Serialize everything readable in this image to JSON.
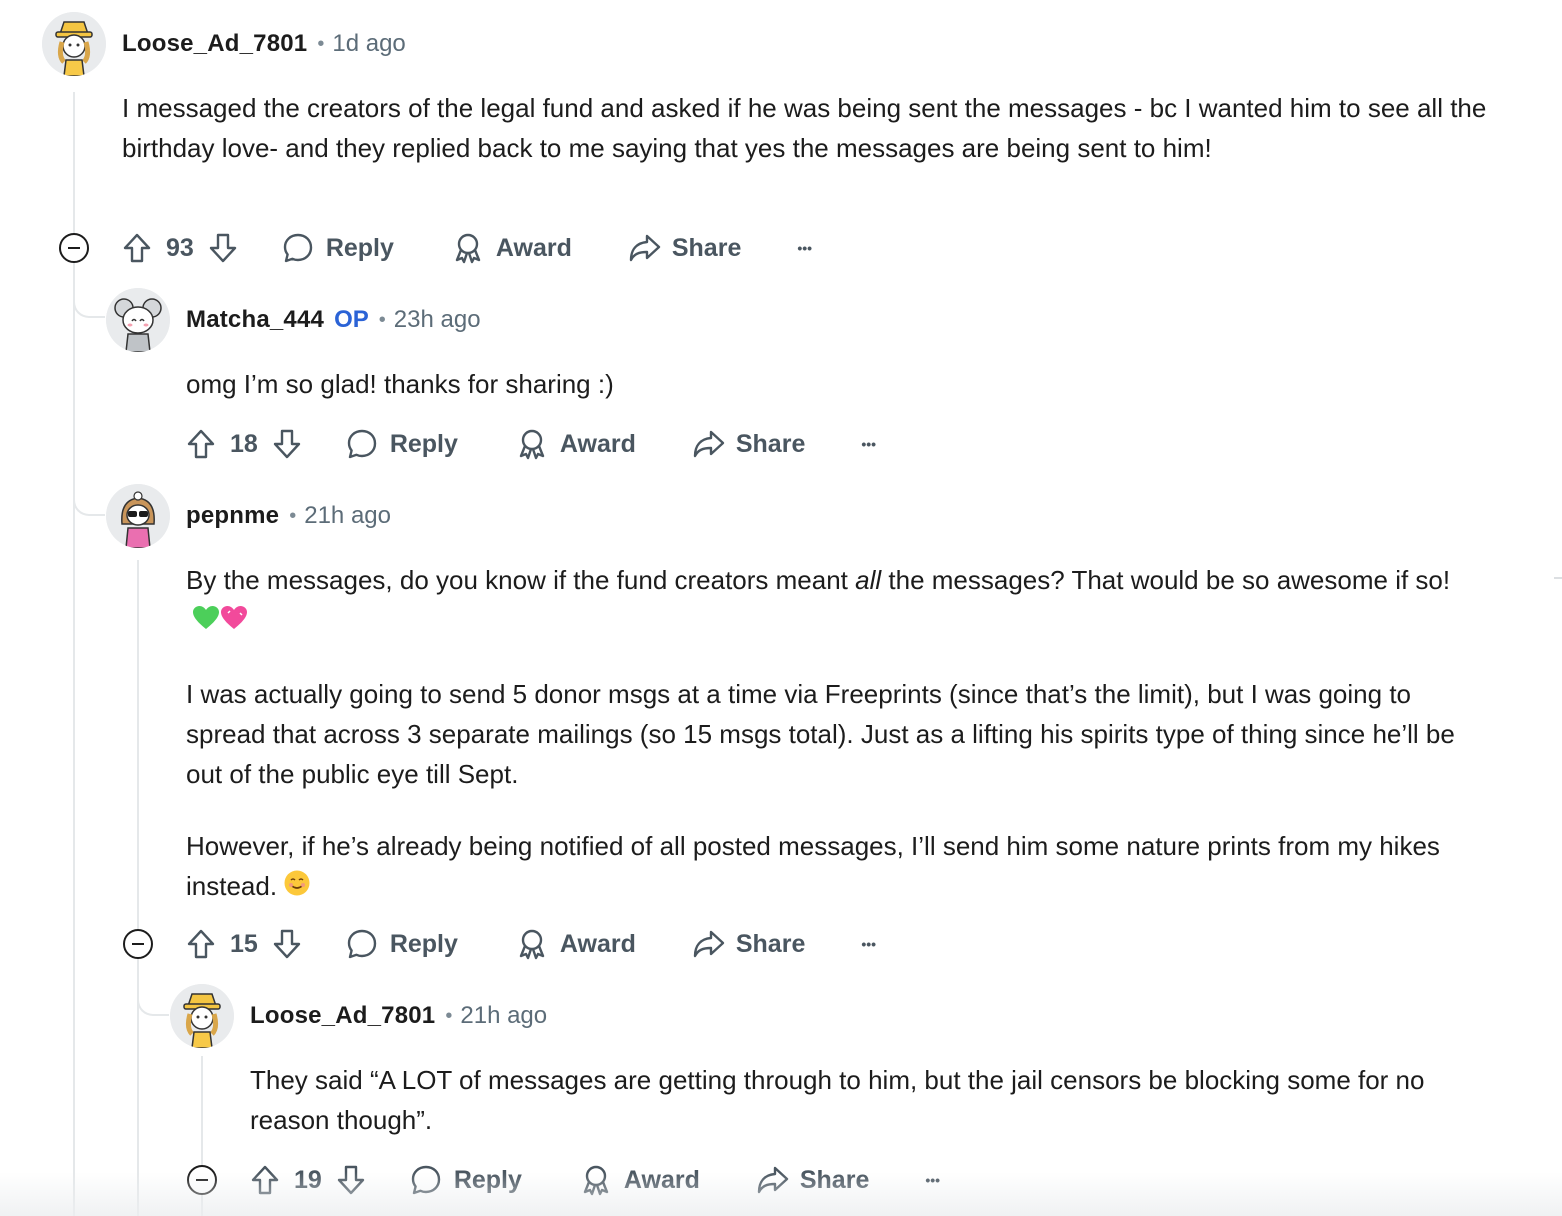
{
  "comments": [
    {
      "author": "Loose_Ad_7801",
      "time": "1d ago",
      "body": [
        "I messaged the creators of the legal fund and asked if he was being sent the messages - bc I wanted him to see all the birthday love- and they replied back to me saying that yes the messages are being sent to him!"
      ],
      "score": "93"
    },
    {
      "author": "Matcha_444",
      "op_badge": "OP",
      "time": "23h ago",
      "body": [
        "omg I’m so glad! thanks for sharing :)"
      ],
      "score": "18"
    },
    {
      "author": "pepnme",
      "time": "21h ago",
      "body_p1_before": "By the messages, do you know if the fund creators meant ",
      "body_p1_em": "all",
      "body_p1_after": " the messages? That would be so awesome if so!",
      "body_p2": "I was actually going to send 5 donor msgs at a time via Freeprints (since that’s the limit), but I was going to spread that across 3 separate mailings (so 15 msgs total). Just as a lifting his spirits type of thing since he’ll be out of the public eye till Sept.",
      "body_p3": "However, if he’s already being notified of all posted messages, I’ll send him some nature prints from my hikes instead.",
      "score": "15"
    },
    {
      "author": "Loose_Ad_7801",
      "time": "21h ago",
      "body": [
        "They said “A LOT of messages are getting through to him, but the jail censors be blocking some for no reason though”."
      ],
      "score": "19"
    }
  ],
  "actions": {
    "reply": "Reply",
    "award": "Award",
    "share": "Share",
    "more": "•••"
  },
  "icons": {
    "upvote": "upvote-arrow-icon",
    "downvote": "downvote-arrow-icon",
    "reply": "speech-bubble-icon",
    "award": "award-ribbon-icon",
    "share": "share-arrow-icon",
    "more": "more-dots-icon",
    "collapse": "collapse-minus-icon"
  },
  "colors": {
    "op_badge": "#2b63d6",
    "text": "#1c1c1c",
    "muted": "#5c6c78",
    "thread_line": "#e5e8ea"
  }
}
